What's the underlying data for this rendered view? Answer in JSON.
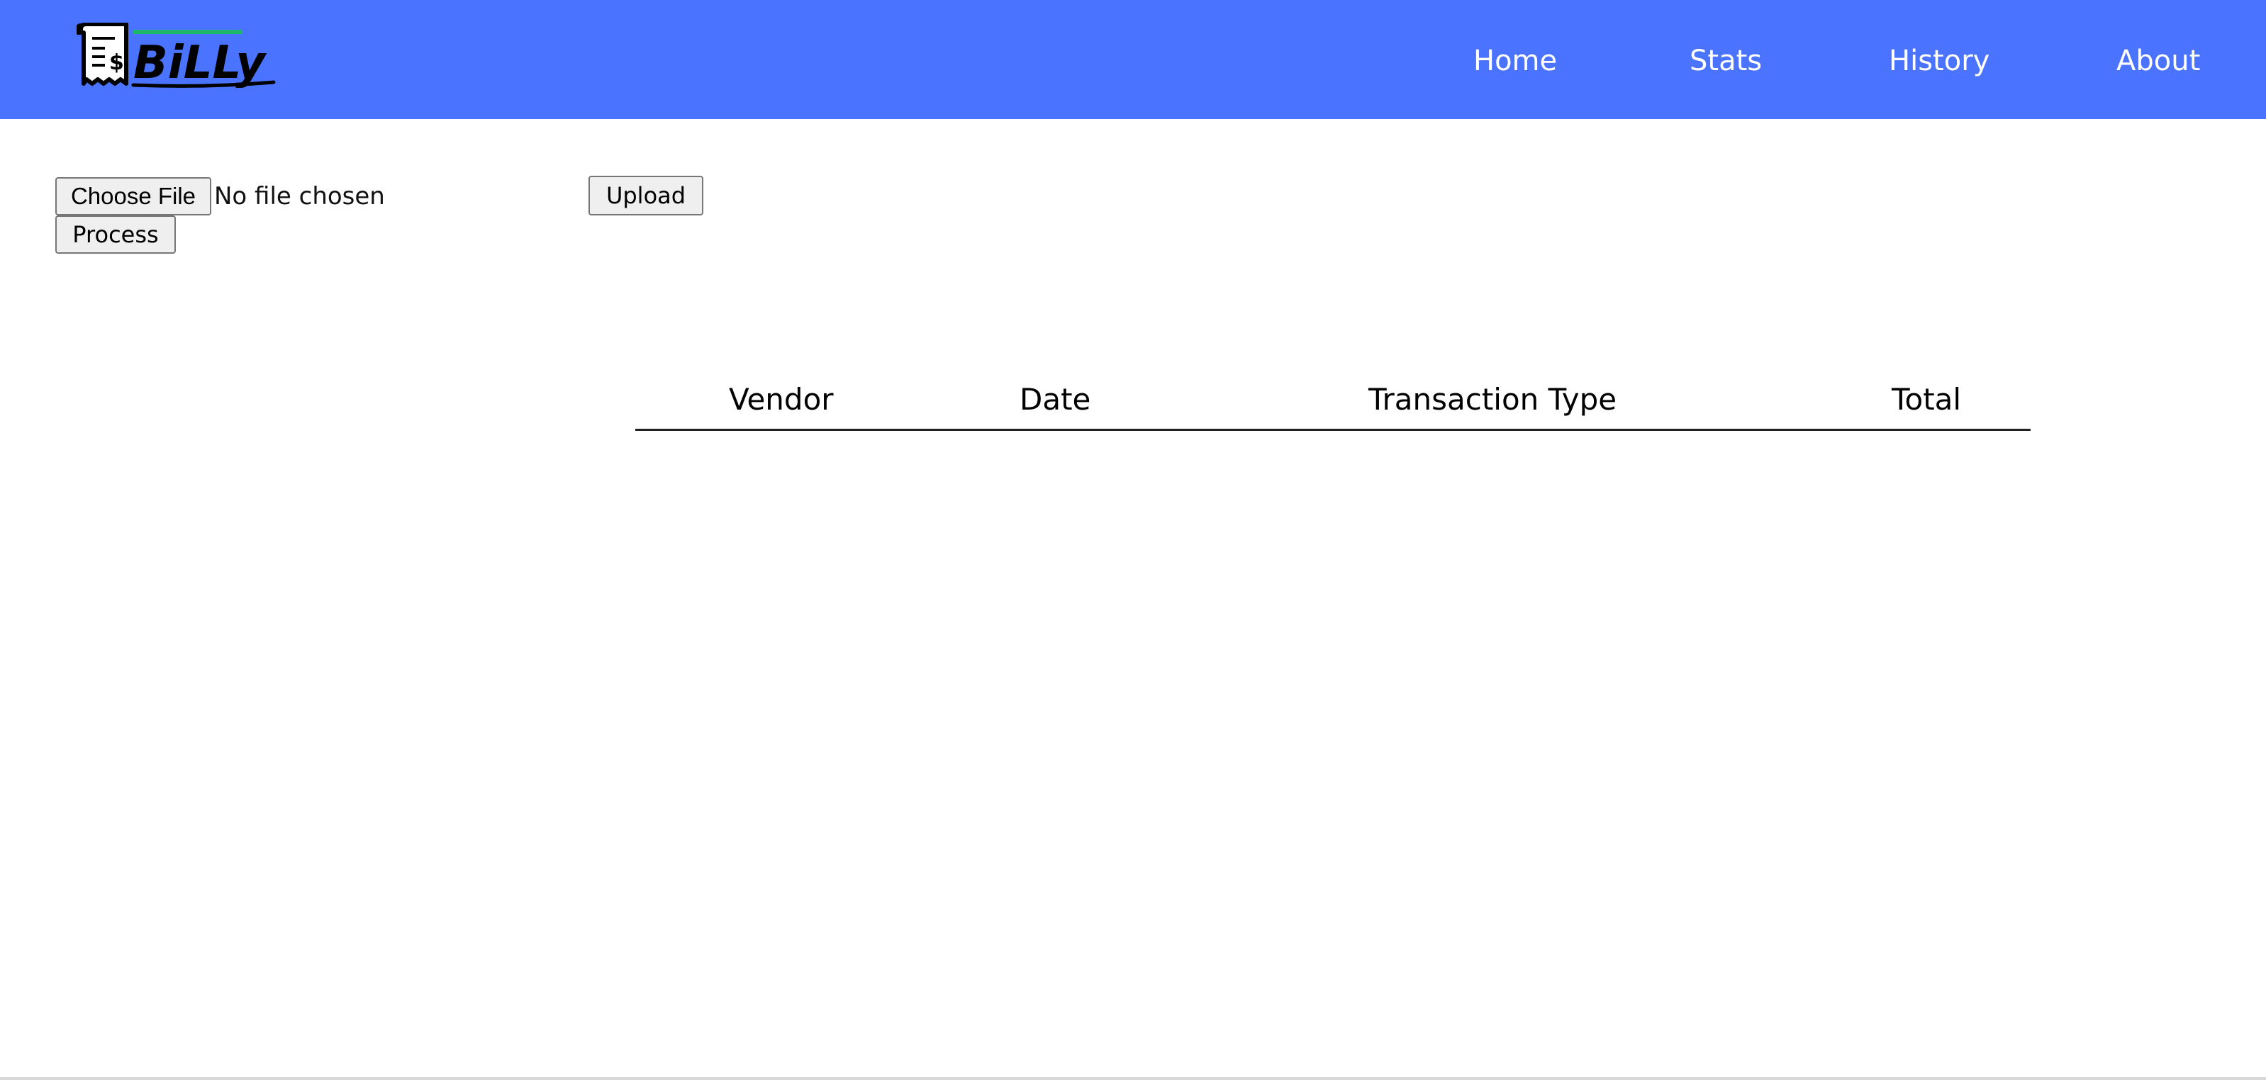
{
  "brand": {
    "name": "BiLLy",
    "logo_icon": "receipt-dollar-icon",
    "accent_color": "#4a74ff",
    "logo_stripe_color": "#1fb86b"
  },
  "nav": {
    "items": [
      {
        "label": "Home"
      },
      {
        "label": "Stats"
      },
      {
        "label": "History"
      },
      {
        "label": "About"
      }
    ]
  },
  "upload": {
    "choose_label": "Choose File",
    "file_status": "No file chosen",
    "upload_label": "Upload",
    "process_label": "Process"
  },
  "table": {
    "columns": [
      "Vendor",
      "Date",
      "Transaction Type",
      "Total"
    ],
    "rows": []
  }
}
